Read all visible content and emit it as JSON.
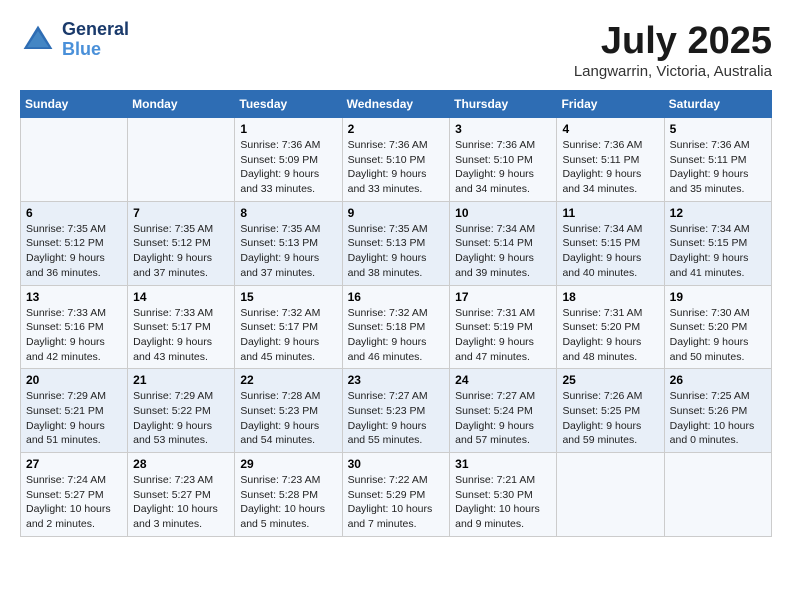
{
  "header": {
    "logo_line1": "General",
    "logo_line2": "Blue",
    "month_title": "July 2025",
    "subtitle": "Langwarrin, Victoria, Australia"
  },
  "days_of_week": [
    "Sunday",
    "Monday",
    "Tuesday",
    "Wednesday",
    "Thursday",
    "Friday",
    "Saturday"
  ],
  "weeks": [
    [
      {
        "day": "",
        "info": ""
      },
      {
        "day": "",
        "info": ""
      },
      {
        "day": "1",
        "info": "Sunrise: 7:36 AM\nSunset: 5:09 PM\nDaylight: 9 hours\nand 33 minutes."
      },
      {
        "day": "2",
        "info": "Sunrise: 7:36 AM\nSunset: 5:10 PM\nDaylight: 9 hours\nand 33 minutes."
      },
      {
        "day": "3",
        "info": "Sunrise: 7:36 AM\nSunset: 5:10 PM\nDaylight: 9 hours\nand 34 minutes."
      },
      {
        "day": "4",
        "info": "Sunrise: 7:36 AM\nSunset: 5:11 PM\nDaylight: 9 hours\nand 34 minutes."
      },
      {
        "day": "5",
        "info": "Sunrise: 7:36 AM\nSunset: 5:11 PM\nDaylight: 9 hours\nand 35 minutes."
      }
    ],
    [
      {
        "day": "6",
        "info": "Sunrise: 7:35 AM\nSunset: 5:12 PM\nDaylight: 9 hours\nand 36 minutes."
      },
      {
        "day": "7",
        "info": "Sunrise: 7:35 AM\nSunset: 5:12 PM\nDaylight: 9 hours\nand 37 minutes."
      },
      {
        "day": "8",
        "info": "Sunrise: 7:35 AM\nSunset: 5:13 PM\nDaylight: 9 hours\nand 37 minutes."
      },
      {
        "day": "9",
        "info": "Sunrise: 7:35 AM\nSunset: 5:13 PM\nDaylight: 9 hours\nand 38 minutes."
      },
      {
        "day": "10",
        "info": "Sunrise: 7:34 AM\nSunset: 5:14 PM\nDaylight: 9 hours\nand 39 minutes."
      },
      {
        "day": "11",
        "info": "Sunrise: 7:34 AM\nSunset: 5:15 PM\nDaylight: 9 hours\nand 40 minutes."
      },
      {
        "day": "12",
        "info": "Sunrise: 7:34 AM\nSunset: 5:15 PM\nDaylight: 9 hours\nand 41 minutes."
      }
    ],
    [
      {
        "day": "13",
        "info": "Sunrise: 7:33 AM\nSunset: 5:16 PM\nDaylight: 9 hours\nand 42 minutes."
      },
      {
        "day": "14",
        "info": "Sunrise: 7:33 AM\nSunset: 5:17 PM\nDaylight: 9 hours\nand 43 minutes."
      },
      {
        "day": "15",
        "info": "Sunrise: 7:32 AM\nSunset: 5:17 PM\nDaylight: 9 hours\nand 45 minutes."
      },
      {
        "day": "16",
        "info": "Sunrise: 7:32 AM\nSunset: 5:18 PM\nDaylight: 9 hours\nand 46 minutes."
      },
      {
        "day": "17",
        "info": "Sunrise: 7:31 AM\nSunset: 5:19 PM\nDaylight: 9 hours\nand 47 minutes."
      },
      {
        "day": "18",
        "info": "Sunrise: 7:31 AM\nSunset: 5:20 PM\nDaylight: 9 hours\nand 48 minutes."
      },
      {
        "day": "19",
        "info": "Sunrise: 7:30 AM\nSunset: 5:20 PM\nDaylight: 9 hours\nand 50 minutes."
      }
    ],
    [
      {
        "day": "20",
        "info": "Sunrise: 7:29 AM\nSunset: 5:21 PM\nDaylight: 9 hours\nand 51 minutes."
      },
      {
        "day": "21",
        "info": "Sunrise: 7:29 AM\nSunset: 5:22 PM\nDaylight: 9 hours\nand 53 minutes."
      },
      {
        "day": "22",
        "info": "Sunrise: 7:28 AM\nSunset: 5:23 PM\nDaylight: 9 hours\nand 54 minutes."
      },
      {
        "day": "23",
        "info": "Sunrise: 7:27 AM\nSunset: 5:23 PM\nDaylight: 9 hours\nand 55 minutes."
      },
      {
        "day": "24",
        "info": "Sunrise: 7:27 AM\nSunset: 5:24 PM\nDaylight: 9 hours\nand 57 minutes."
      },
      {
        "day": "25",
        "info": "Sunrise: 7:26 AM\nSunset: 5:25 PM\nDaylight: 9 hours\nand 59 minutes."
      },
      {
        "day": "26",
        "info": "Sunrise: 7:25 AM\nSunset: 5:26 PM\nDaylight: 10 hours\nand 0 minutes."
      }
    ],
    [
      {
        "day": "27",
        "info": "Sunrise: 7:24 AM\nSunset: 5:27 PM\nDaylight: 10 hours\nand 2 minutes."
      },
      {
        "day": "28",
        "info": "Sunrise: 7:23 AM\nSunset: 5:27 PM\nDaylight: 10 hours\nand 3 minutes."
      },
      {
        "day": "29",
        "info": "Sunrise: 7:23 AM\nSunset: 5:28 PM\nDaylight: 10 hours\nand 5 minutes."
      },
      {
        "day": "30",
        "info": "Sunrise: 7:22 AM\nSunset: 5:29 PM\nDaylight: 10 hours\nand 7 minutes."
      },
      {
        "day": "31",
        "info": "Sunrise: 7:21 AM\nSunset: 5:30 PM\nDaylight: 10 hours\nand 9 minutes."
      },
      {
        "day": "",
        "info": ""
      },
      {
        "day": "",
        "info": ""
      }
    ]
  ]
}
